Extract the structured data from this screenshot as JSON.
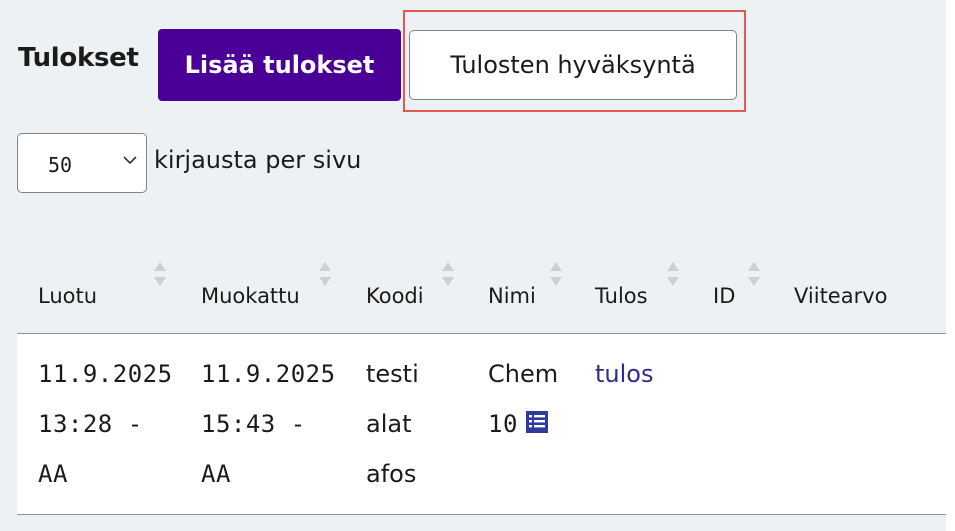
{
  "header": {
    "title": "Tulokset",
    "add_button": "Lisää tulokset",
    "approve_button": "Tulosten hyväksyntä"
  },
  "pagination": {
    "per_page_value": "50",
    "per_page_label": "kirjausta per sivu"
  },
  "table": {
    "columns": [
      "Luotu",
      "Muokattu",
      "Koodi",
      "Nimi",
      "Tulos",
      "ID",
      "Viitearvo"
    ],
    "rows": [
      {
        "luotu": [
          "11.9.2025",
          "13:28 -",
          "AA"
        ],
        "muokattu": [
          "11.9.2025",
          "15:43 -",
          "AA"
        ],
        "koodi": [
          "testi",
          "alat",
          "afos"
        ],
        "nimi": [
          "Chem",
          "10"
        ],
        "tulos": "tulos",
        "id": "",
        "viitearvo": ""
      }
    ]
  },
  "colors": {
    "primary": "#4a0096",
    "link": "#2e2c8e",
    "highlight": "#e05a52",
    "background": "#eef1f3"
  }
}
